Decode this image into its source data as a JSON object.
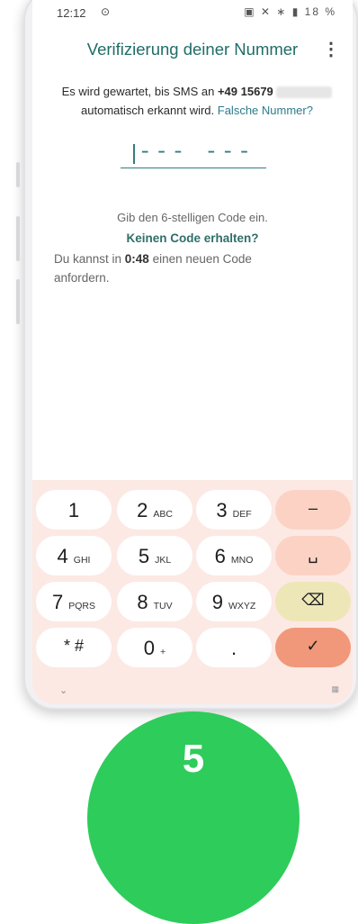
{
  "status_bar": {
    "time": "12:12",
    "location_icon": "location-icon",
    "battery": "18 %"
  },
  "header": {
    "title": "Verifizierung deiner Nummer",
    "menu_icon": "more-vert-icon"
  },
  "message": {
    "prefix": "Es wird gewartet, bis SMS an ",
    "phone": "+49 15679",
    "suffix": "automatisch erkannt wird.",
    "wrong_number_link": "Falsche Nummer?"
  },
  "code_input": {
    "placeholder": "--- ---"
  },
  "hint": "Gib den 6-stelligen Code ein.",
  "no_code": "Keinen Code erhalten?",
  "resend": {
    "before": "Du kannst in ",
    "countdown": "0:48",
    "after": " einen neuen Code anfordern."
  },
  "keypad": {
    "rows": [
      [
        {
          "num": "1",
          "sub": ""
        },
        {
          "num": "2",
          "sub": "ABC"
        },
        {
          "num": "3",
          "sub": "DEF"
        },
        {
          "num": "–",
          "sub": ""
        }
      ],
      [
        {
          "num": "4",
          "sub": "GHI"
        },
        {
          "num": "5",
          "sub": "JKL"
        },
        {
          "num": "6",
          "sub": "MNO"
        },
        {
          "num": "␣",
          "sub": ""
        }
      ],
      [
        {
          "num": "7",
          "sub": "PQRS"
        },
        {
          "num": "8",
          "sub": "TUV"
        },
        {
          "num": "9",
          "sub": "WXYZ"
        },
        {
          "num": "⌫",
          "sub": ""
        }
      ],
      [
        {
          "num": "* #",
          "sub": ""
        },
        {
          "num": "0",
          "sub": "+"
        },
        {
          "num": ".",
          "sub": ""
        },
        {
          "num": "✓",
          "sub": ""
        }
      ]
    ]
  },
  "step_badge": "5",
  "colors": {
    "accent": "#1f6d68",
    "link": "#2c7c8c",
    "keyboard_bg": "#fce9e4",
    "ok_key": "#f1977a",
    "badge": "#2ecc5b"
  }
}
